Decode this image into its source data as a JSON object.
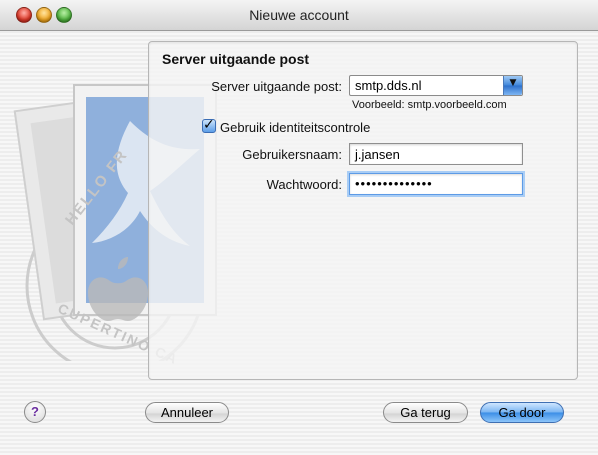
{
  "window": {
    "title": "Nieuwe account",
    "controls": [
      "close",
      "minimize",
      "zoom"
    ]
  },
  "panel": {
    "heading": "Server uitgaande post",
    "server": {
      "label": "Server uitgaande post:",
      "value": "smtp.dds.nl",
      "hint": "Voorbeeld: smtp.voorbeeld.com"
    },
    "auth": {
      "label": "Gebruik identiteitscontrole",
      "checked": true
    },
    "username": {
      "label": "Gebruikersnaam:",
      "value": "j.jansen"
    },
    "password": {
      "label": "Wachtwoord:",
      "masked_value": "••••••••••••••"
    }
  },
  "buttons": {
    "help": "?",
    "cancel": "Annuleer",
    "back": "Ga terug",
    "next": "Ga door"
  },
  "illustration": {
    "stamp_text_top": "HELLO FR",
    "stamp_text_bottom": "CUPERTINO CA"
  },
  "colors": {
    "accent": "#3a8de6",
    "stamp_blue": "#8fb0dc"
  }
}
